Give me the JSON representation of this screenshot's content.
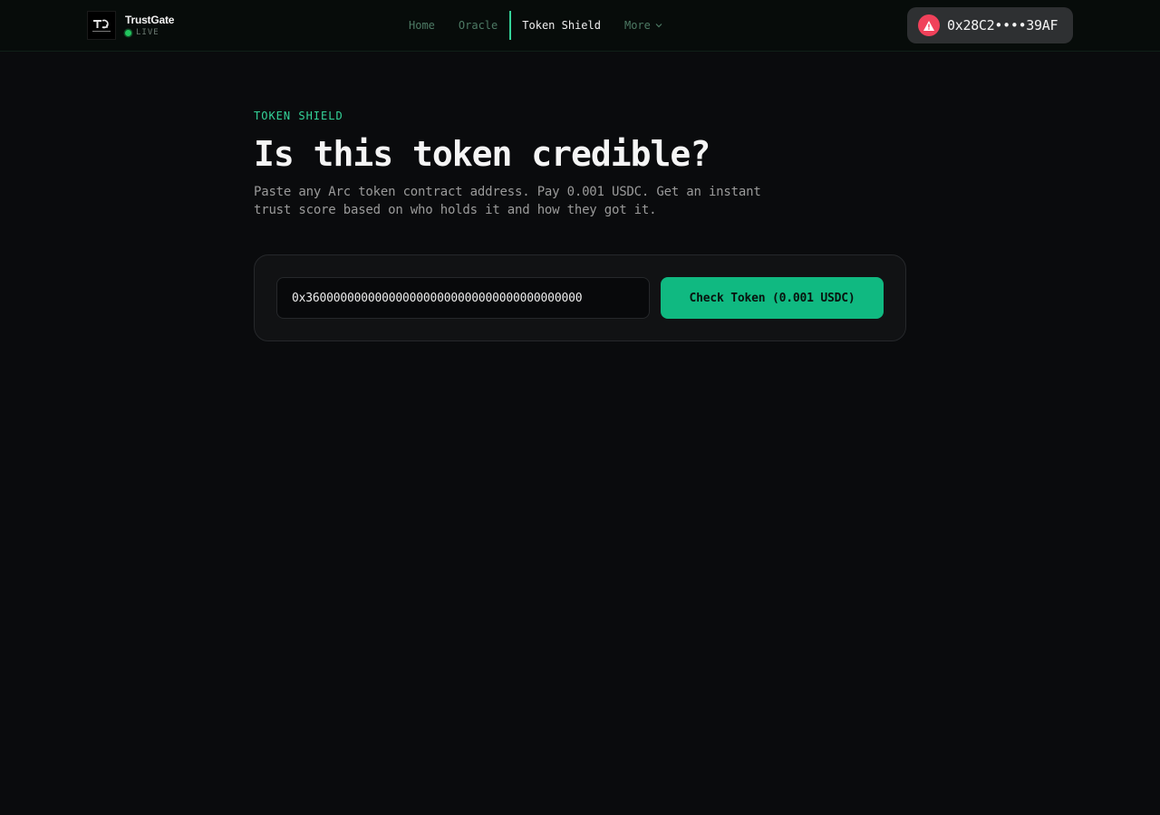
{
  "brand": {
    "name": "TrustGate",
    "status": "LIVE",
    "logo": "trustgate-logo-icon"
  },
  "nav": {
    "items": [
      {
        "label": "Home",
        "active": false
      },
      {
        "label": "Oracle",
        "active": false
      },
      {
        "label": "Token Shield",
        "active": true
      },
      {
        "label": "More",
        "active": false,
        "icon": "chevron-down-icon"
      }
    ]
  },
  "wallet": {
    "address": "0x28C2••••39AF",
    "icon": "warning-icon"
  },
  "main": {
    "section_label": "TOKEN SHIELD",
    "title": "Is this token credible?",
    "description": "Paste any Arc token contract address. Pay 0.001 USDC. Get an instant trust score based on who holds it and how they got it."
  },
  "form": {
    "address_value": "0x3600000000000000000000000000000000000000",
    "button_label": "Check Token (0.001 USDC)"
  },
  "colors": {
    "accent": "#10b981",
    "accent_text": "#34d399",
    "warning": "#f0415a",
    "background": "#0a0b0d"
  }
}
